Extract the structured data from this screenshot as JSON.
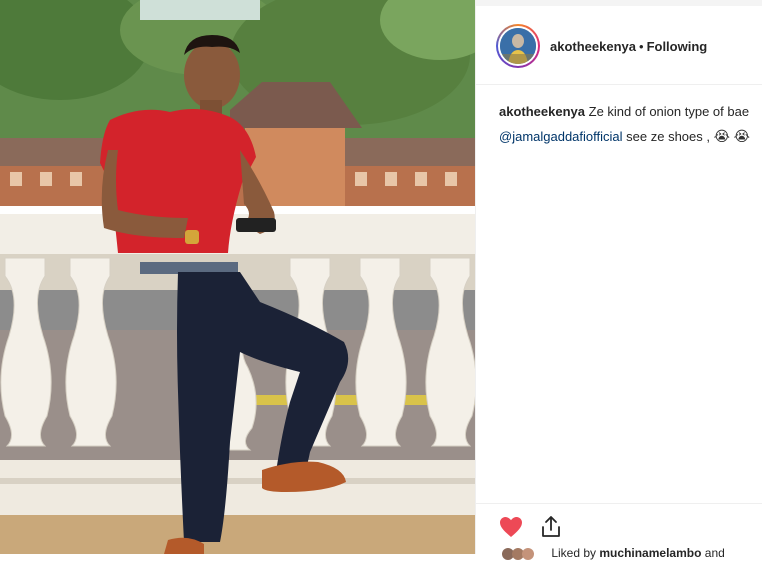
{
  "post": {
    "username": "akotheekenya",
    "separator": "•",
    "follow_status": "Following",
    "caption": {
      "username": "akotheekenya",
      "text": "Ze kind of onion type of bae",
      "mention": "@jamalgaddafiofficial",
      "text2": "see ze shoes ,",
      "emojis": [
        "😭",
        "😭"
      ]
    },
    "actions": {
      "like_icon": "heart-filled-icon",
      "share_icon": "share-icon"
    },
    "likes": {
      "prefix": "Liked by",
      "user": "muchinamelambo",
      "suffix": "and"
    }
  },
  "colors": {
    "heart": "#ed4956",
    "mention": "#003569",
    "text": "#262626"
  }
}
